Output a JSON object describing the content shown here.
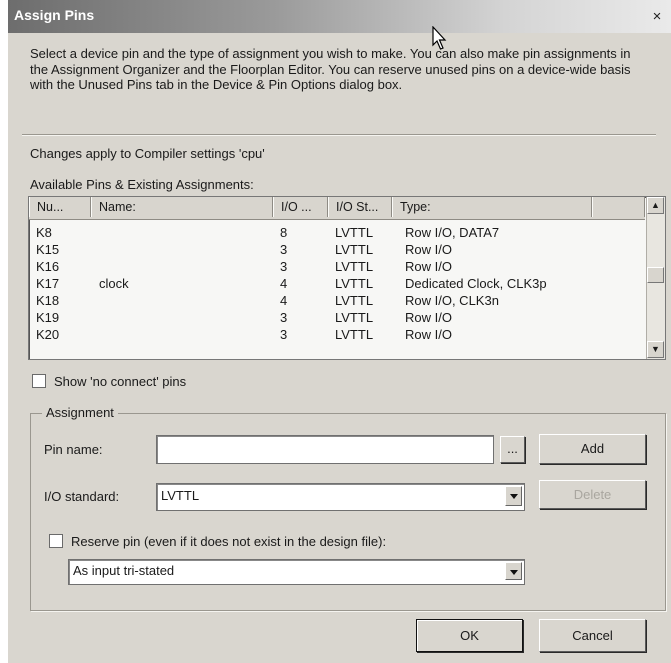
{
  "window": {
    "title": "Assign Pins",
    "close_glyph": "×"
  },
  "intro_text": "Select a device pin and the type of assignment you wish to make.  You can also make pin assignments in the Assignment Organizer and the Floorplan Editor.  You can reserve unused pins on a device-wide basis with the Unused Pins tab in the Device & Pin Options dialog box.",
  "compiler_settings_text": "Changes apply to Compiler settings 'cpu'",
  "available_label": "Available Pins & Existing Assignments:",
  "pin_list": {
    "columns": [
      "Nu...",
      "Name:",
      "I/O ...",
      "I/O St...",
      "Type:"
    ],
    "rows": [
      {
        "num": "K8",
        "name": "",
        "io_bank": "8",
        "io_standard": "LVTTL",
        "type": "Row I/O, DATA7"
      },
      {
        "num": "K15",
        "name": "",
        "io_bank": "3",
        "io_standard": "LVTTL",
        "type": "Row I/O"
      },
      {
        "num": "K16",
        "name": "",
        "io_bank": "3",
        "io_standard": "LVTTL",
        "type": "Row I/O"
      },
      {
        "num": "K17",
        "name": "clock",
        "io_bank": "4",
        "io_standard": "LVTTL",
        "type": "Dedicated Clock, CLK3p"
      },
      {
        "num": "K18",
        "name": "",
        "io_bank": "4",
        "io_standard": "LVTTL",
        "type": "Row I/O, CLK3n"
      },
      {
        "num": "K19",
        "name": "",
        "io_bank": "3",
        "io_standard": "LVTTL",
        "type": "Row I/O"
      },
      {
        "num": "K20",
        "name": "",
        "io_bank": "3",
        "io_standard": "LVTTL",
        "type": "Row I/O"
      }
    ]
  },
  "show_no_connect": {
    "label": "Show 'no connect' pins",
    "checked": false
  },
  "assignment": {
    "group_label": "Assignment",
    "pin_name_label": "Pin name:",
    "pin_name_value": "",
    "browse_label": "...",
    "add_label": "Add",
    "io_standard_label": "I/O standard:",
    "io_standard_value": "LVTTL",
    "delete_label": "Delete",
    "reserve_label": "Reserve pin (even if it does not exist in the design file):",
    "reserve_checked": false,
    "reserve_option_value": "As input tri-stated"
  },
  "buttons": {
    "ok": "OK",
    "cancel": "Cancel"
  },
  "colors": {
    "titlebar_start": "#6d6d6d",
    "titlebar_end": "#eaeaea",
    "dialog_bg": "#d9d6cf"
  }
}
